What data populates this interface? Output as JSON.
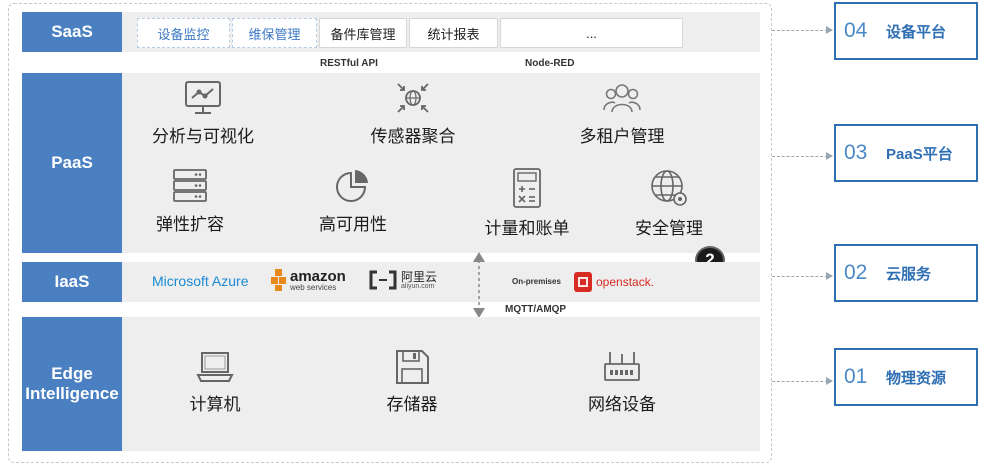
{
  "layers": {
    "saas": "SaaS",
    "paas": "PaaS",
    "iaas": "IaaS",
    "edge": "Edge\nIntelligence"
  },
  "saas_items": [
    "设备监控",
    "维保管理",
    "备件库管理",
    "统计报表",
    "..."
  ],
  "protocols": {
    "restful": "RESTful API",
    "nodered": "Node-RED",
    "mqtt": "MQTT/AMQP"
  },
  "paas_items": [
    {
      "label": "分析与可视化",
      "icon": "monitor-chart-icon"
    },
    {
      "label": "传感器聚合",
      "icon": "globe-converge-icon"
    },
    {
      "label": "多租户管理",
      "icon": "users-group-icon"
    },
    {
      "label": "弹性扩容",
      "icon": "server-stack-icon"
    },
    {
      "label": "高可用性",
      "icon": "pie-chart-icon"
    },
    {
      "label": "计量和账单",
      "icon": "calculator-icon"
    },
    {
      "label": "安全管理",
      "icon": "globe-gear-icon"
    }
  ],
  "iaas_vendors": {
    "azure": "Microsoft Azure",
    "amazon": "amazon",
    "amazon_sub": "web services",
    "aliyun": "阿里云",
    "aliyun_sub": "aliyun.com",
    "onprem": "On-premises",
    "openstack": "openstack."
  },
  "badge": "2",
  "edge_items": [
    {
      "label": "计算机",
      "icon": "laptop-icon"
    },
    {
      "label": "存储器",
      "icon": "floppy-disk-icon"
    },
    {
      "label": "网络设备",
      "icon": "router-icon"
    }
  ],
  "platforms": [
    {
      "num": "04",
      "name": "设备平台"
    },
    {
      "num": "03",
      "name": "PaaS平台"
    },
    {
      "num": "02",
      "name": "云服务"
    },
    {
      "num": "01",
      "name": "物理资源"
    }
  ],
  "colors": {
    "layer_blue": "#4a7fc1",
    "band_gray": "#eeeeee",
    "box_border": "#2f6fb3",
    "openstack_red": "#d72c24",
    "azure_blue": "#1a8ad4"
  }
}
